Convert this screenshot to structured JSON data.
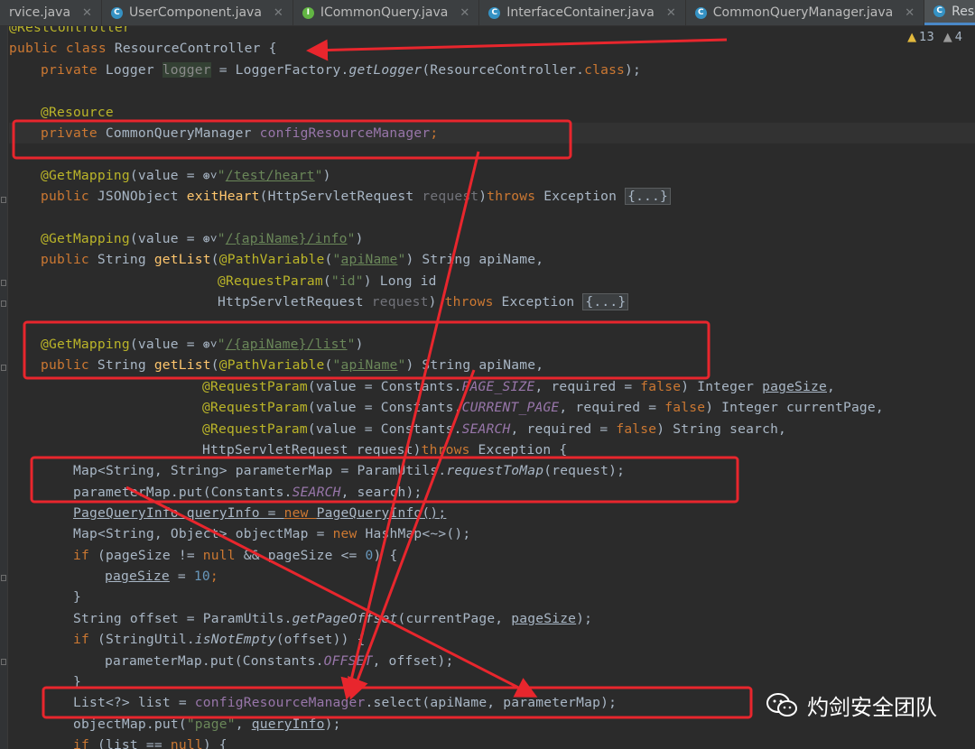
{
  "tabs": [
    {
      "label": "rvice.java",
      "icon": "none",
      "active": false
    },
    {
      "label": "UserComponent.java",
      "icon": "class-icon",
      "active": false
    },
    {
      "label": "ICommonQuery.java",
      "icon": "interface-icon",
      "active": false
    },
    {
      "label": "InterfaceContainer.java",
      "icon": "class-icon",
      "active": false
    },
    {
      "label": "CommonQueryManager.java",
      "icon": "class-icon",
      "active": false
    },
    {
      "label": "ResourceController.ja",
      "icon": "class-icon",
      "active": true
    }
  ],
  "inspections": {
    "warnings": "13",
    "weak_warnings": "4"
  },
  "code": {
    "l0": "@RestController",
    "l1a": "public class ",
    "l1b": "ResourceController {",
    "l2a": "private ",
    "l2b": "Logger ",
    "l2c": "logger",
    "l2d": " = LoggerFactory.",
    "l2e": "getLogger",
    "l2f": "(ResourceController.",
    "l2g": "class",
    "l2h": ");",
    "l4": "@Resource",
    "l5a": "private ",
    "l5b": "CommonQueryManager ",
    "l5c": "configResourceManager",
    "l5d": ";",
    "l7a": "@GetMapping",
    "l7b": "(value = ",
    "l7c": "\"",
    "l7d": "/test/heart",
    "l7e": "\"",
    "l7f": ")",
    "l8a": "public ",
    "l8b": "JSONObject ",
    "l8c": "exitHeart",
    "l8d": "(HttpServletRequest ",
    "l8e": "request",
    "l8f": ")",
    "l8g": "throws ",
    "l8h": "Exception ",
    "l8i": "{...}",
    "l10a": "@GetMapping",
    "l10b": "(value = ",
    "l10c": "\"",
    "l10d": "/{apiName}/info",
    "l10e": "\"",
    "l10f": ")",
    "l11a": "public ",
    "l11b": "String ",
    "l11c": "getList",
    "l11d": "(",
    "l11e": "@PathVariable",
    "l11f": "(",
    "l11g": "\"",
    "l11h": "apiName",
    "l11i": "\"",
    "l11j": ") String apiName,",
    "l12a": "@RequestParam",
    "l12b": "(",
    "l12c": "\"id\"",
    "l12d": ") Long id",
    "l13a": "HttpServletRequest ",
    "l13b": "request",
    "l13c": ") ",
    "l13d": "throws ",
    "l13e": "Exception ",
    "l13f": "{...}",
    "l15a": "@GetMapping",
    "l15b": "(value = ",
    "l15c": "\"",
    "l15d": "/{apiName}/list",
    "l15e": "\"",
    "l15f": ")",
    "l16a": "public ",
    "l16b": "String ",
    "l16c": "getList",
    "l16d": "(",
    "l16e": "@PathVariable",
    "l16f": "(",
    "l16g": "\"",
    "l16h": "apiName",
    "l16i": "\"",
    "l16j": ") String apiName,",
    "l17a": "@RequestParam",
    "l17b": "(value = Constants.",
    "l17c": "PAGE_SIZE",
    "l17d": ", required = ",
    "l17e": "false",
    "l17f": ") Integer ",
    "l17g": "pageSize",
    "l17h": ",",
    "l18a": "@RequestParam",
    "l18b": "(value = Constants.",
    "l18c": "CURRENT_PAGE",
    "l18d": ", required = ",
    "l18e": "false",
    "l18f": ") Integer currentPage,",
    "l19a": "@RequestParam",
    "l19b": "(value = Constants.",
    "l19c": "SEARCH",
    "l19d": ", required = ",
    "l19e": "false",
    "l19f": ") String search,",
    "l20a": "HttpServletRequest request",
    "l20b": ")",
    "l20c": "throws ",
    "l20d": "Exception {",
    "l21a": "Map<String, String> parameterMap = ParamUtils.",
    "l21b": "requestToMap",
    "l21c": "(request);",
    "l22a": "parameterMap.put(Constants.",
    "l22b": "SEARCH",
    "l22c": ", search);",
    "l23a": "PageQueryInfo queryInfo = ",
    "l23b": "new ",
    "l23c": "PageQueryInfo();",
    "l24a": "Map<String, Object> objectMap = ",
    "l24b": "new ",
    "l24c": "HashMap<~>();",
    "l25a": "if ",
    "l25b": "(pageSize != ",
    "l25c": "null ",
    "l25d": "&& pageSize <= ",
    "l25e": "0",
    "l25f": ") {",
    "l26a": "pageSize",
    "l26b": " = ",
    "l26c": "10",
    "l26d": ";",
    "l27": "}",
    "l28a": "String offset = ParamUtils.",
    "l28b": "getPageOffset",
    "l28c": "(currentPage, ",
    "l28d": "pageSize",
    "l28e": ");",
    "l29a": "if ",
    "l29b": "(StringUtil.",
    "l29c": "isNotEmpty",
    "l29d": "(offset)) {",
    "l30a": "parameterMap.put(Constants.",
    "l30b": "OFFSET",
    "l30c": ", offset);",
    "l31": "}",
    "l32a": "List<?> list = ",
    "l32b": "configResourceManager",
    "l32c": ".select(apiName, parameterMap);",
    "l33a": "objectMap.put(",
    "l33b": "\"page\"",
    "l33c": ", ",
    "l33d": "queryInfo",
    "l33e": ");",
    "l34a": "if ",
    "l34b": "(list == ",
    "l34c": "null",
    "l34d": ") {"
  },
  "watermark": {
    "text": "灼剑安全团队",
    "icon": "wechat-icon"
  },
  "annotation_color": "#e8262d"
}
